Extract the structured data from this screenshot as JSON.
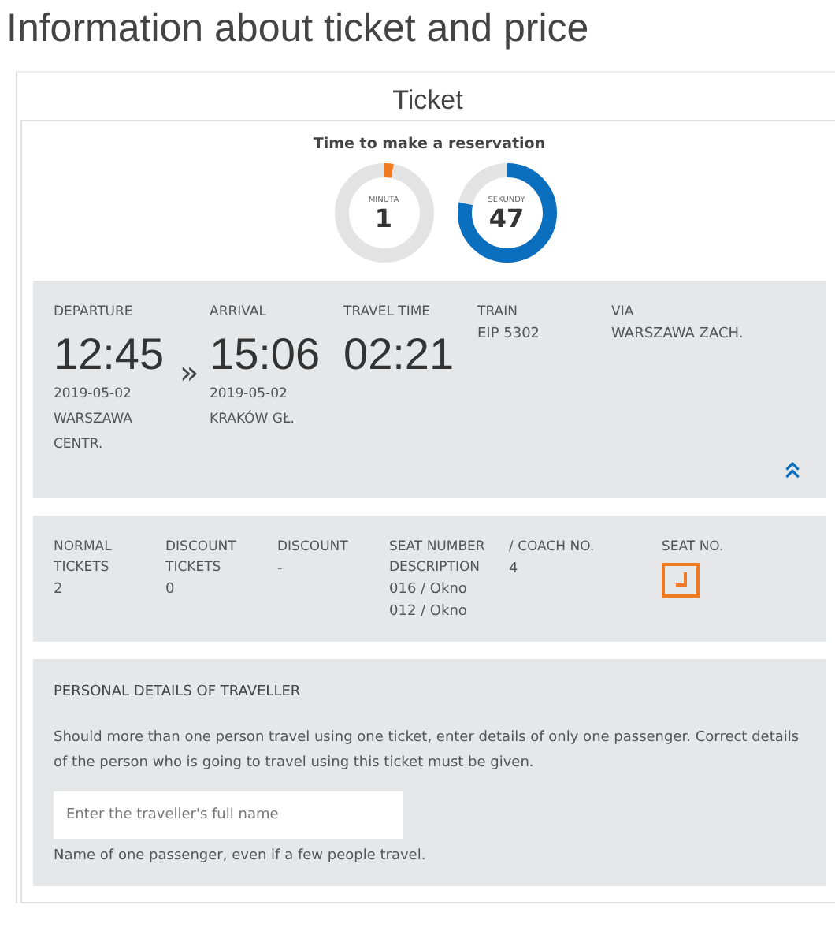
{
  "page_title": "Information about ticket and price",
  "ticket": {
    "heading": "Ticket",
    "timer": {
      "title": "Time to make a reservation",
      "dials": [
        {
          "label": "MINUTA",
          "value": "1"
        },
        {
          "label": "SEKUNDY",
          "value": "47"
        }
      ]
    },
    "journey": {
      "columns": [
        {
          "kind": "stop",
          "label": "DEPARTURE",
          "time": "12:45",
          "date": "2019-05-02",
          "station": "WARSZAWA CENTR."
        },
        {
          "kind": "arrow",
          "text": "»"
        },
        {
          "kind": "stop",
          "label": "ARRIVAL",
          "time": "15:06",
          "date": "2019-05-02",
          "station": "KRAKÓW GŁ."
        },
        {
          "kind": "duration",
          "label": "TRAVEL TIME",
          "time": "02:21"
        },
        {
          "kind": "info",
          "label": "TRAIN",
          "value": "EIP 5302"
        },
        {
          "kind": "info",
          "label": "VIA",
          "value": "WARSZAWA ZACH."
        }
      ]
    },
    "tickets": {
      "columns": [
        {
          "kind": "text",
          "label": "NORMAL TICKETS",
          "values": [
            "2"
          ]
        },
        {
          "kind": "text",
          "label": "DISCOUNT TICKETS",
          "values": [
            "0"
          ]
        },
        {
          "kind": "text",
          "label": "DISCOUNT",
          "values": [
            "-"
          ]
        },
        {
          "kind": "text",
          "label": "SEAT NUMBER DESCRIPTION",
          "values": [
            "016 / Okno",
            "012 / Okno"
          ]
        },
        {
          "kind": "text",
          "label": "/ COACH NO.",
          "values": [
            "4"
          ]
        },
        {
          "kind": "seat",
          "label": "SEAT NO."
        }
      ]
    },
    "traveller": {
      "heading": "PERSONAL DETAILS OF TRAVELLER",
      "description": "Should more than one person travel using one ticket, enter details of only one passenger. Correct details of the person who is going to travel using this ticket must be given.",
      "placeholder": "Enter the traveller's full name",
      "hint": "Name of one passenger, even if a few people travel."
    }
  }
}
